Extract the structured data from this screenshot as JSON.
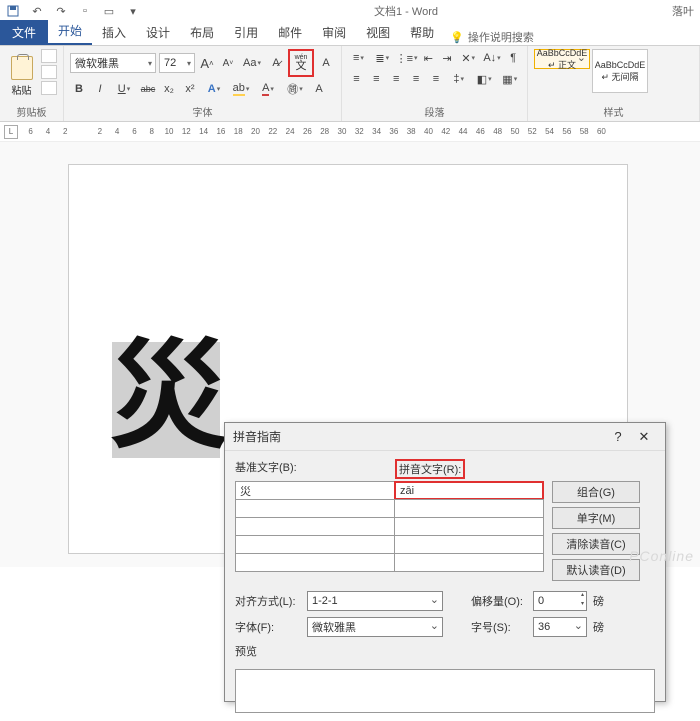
{
  "titlebar": {
    "doc_title": "文档1 - Word",
    "user": "落叶"
  },
  "tabs": {
    "file": "文件",
    "items": [
      "开始",
      "插入",
      "设计",
      "布局",
      "引用",
      "邮件",
      "审阅",
      "视图",
      "帮助"
    ],
    "tell_me": "操作说明搜索"
  },
  "ribbon": {
    "clipboard": {
      "label": "剪贴板",
      "paste": "粘贴"
    },
    "font": {
      "label": "字体",
      "name": "微软雅黑",
      "size": "72",
      "grow": "A",
      "shrink": "A",
      "case": "Aa",
      "clear": "Aρ",
      "bold": "B",
      "italic": "I",
      "underline": "U",
      "strike": "abc",
      "sub": "x₂",
      "sup": "x²",
      "effects": "A",
      "highlight": "ab",
      "color": "A",
      "phonetic_top": "wén",
      "phonetic_char": "文",
      "border": "▢"
    },
    "paragraph": {
      "label": "段落"
    },
    "styles": {
      "label": "样式",
      "s1_preview": "AaBbCcDdE",
      "s1_name": "↵ 正文",
      "s2_preview": "AaBbCcDdE",
      "s2_name": "↵ 无间隔"
    }
  },
  "ruler": {
    "marker": "L",
    "nums": [
      "6",
      "4",
      "2",
      "",
      "2",
      "4",
      "6",
      "8",
      "10",
      "12",
      "14",
      "16",
      "18",
      "20",
      "22",
      "24",
      "26",
      "28",
      "30",
      "32",
      "34",
      "36",
      "38",
      "40",
      "42",
      "44",
      "46",
      "48",
      "50",
      "52",
      "54",
      "56",
      "58",
      "60"
    ]
  },
  "document": {
    "big_char": "災"
  },
  "dialog": {
    "title": "拼音指南",
    "help": "?",
    "close": "✕",
    "base_label": "基准文字(B):",
    "ruby_label": "拼音文字(R):",
    "base_val": "災",
    "ruby_val": "zāi",
    "btn_group": "组合(G)",
    "btn_single": "单字(M)",
    "btn_clear": "清除读音(C)",
    "btn_default": "默认读音(D)",
    "align_label": "对齐方式(L):",
    "align_val": "1-2-1",
    "offset_label": "偏移量(O):",
    "offset_val": "0",
    "offset_unit": "磅",
    "font_label": "字体(F):",
    "font_val": "微软雅黑",
    "size_label": "字号(S):",
    "size_val": "36",
    "size_unit": "磅",
    "preview_label": "预览"
  },
  "watermark": "PConline"
}
